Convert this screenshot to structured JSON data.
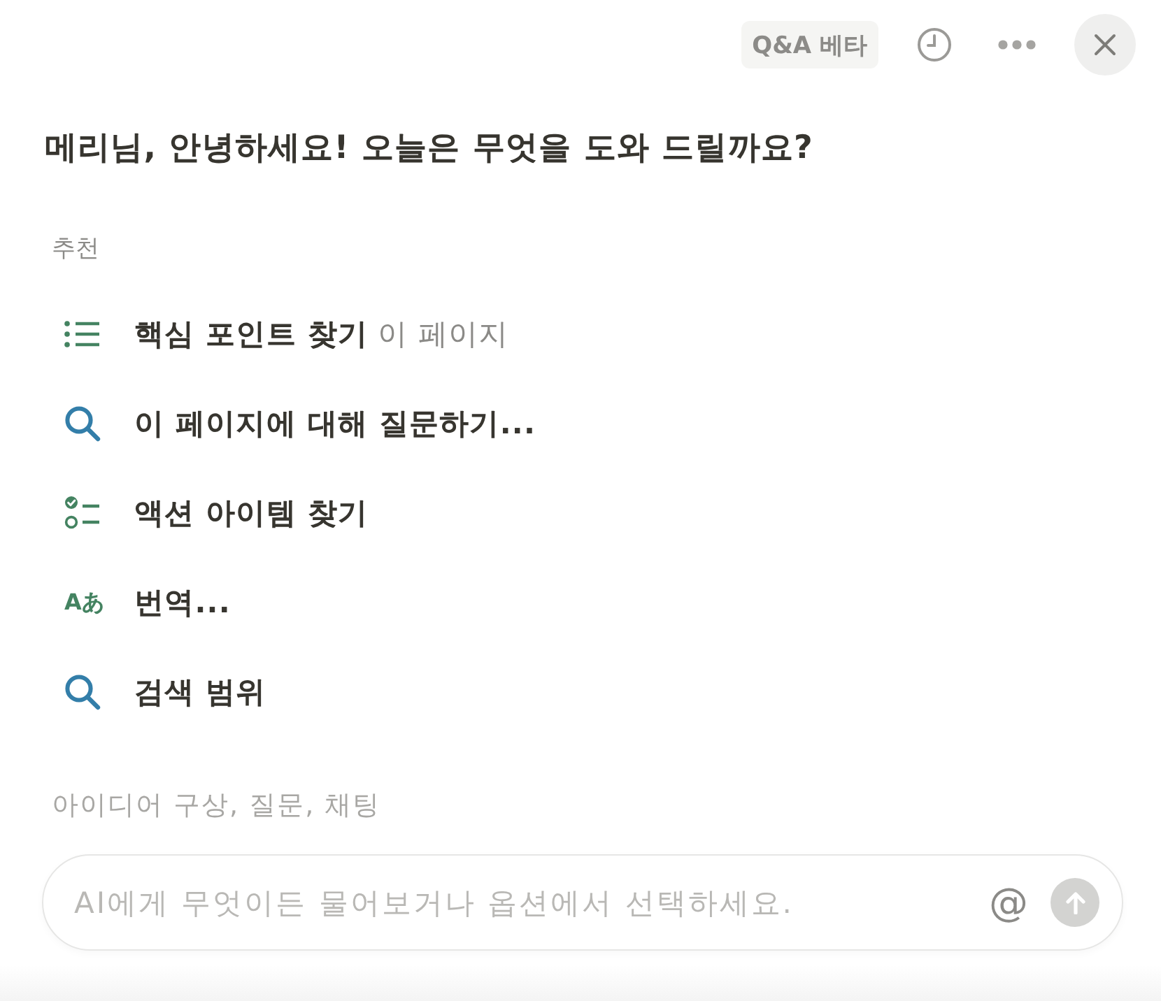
{
  "header": {
    "badge": "Q&A 베타"
  },
  "greeting": "메리님, 안녕하세요! 오늘은 무엇을 도와 드릴까요?",
  "suggestions": {
    "heading": "추천",
    "items": [
      {
        "kind": "list",
        "label": "핵심 포인트 찾기",
        "context": "이 페이지"
      },
      {
        "kind": "search",
        "label": "이 페이지에 대해 질문하기..."
      },
      {
        "kind": "checklist",
        "label": "액션 아이템 찾기"
      },
      {
        "kind": "translate",
        "glyph": "Aあ",
        "label": "번역..."
      },
      {
        "kind": "search",
        "label": "검색 범위"
      }
    ]
  },
  "hint": "아이디어 구상, 질문, 채팅",
  "input": {
    "placeholder": "AI에게 무엇이든 물어보거나 옵션에서 선택하세요.",
    "mention": "@",
    "send_disabled": true
  }
}
